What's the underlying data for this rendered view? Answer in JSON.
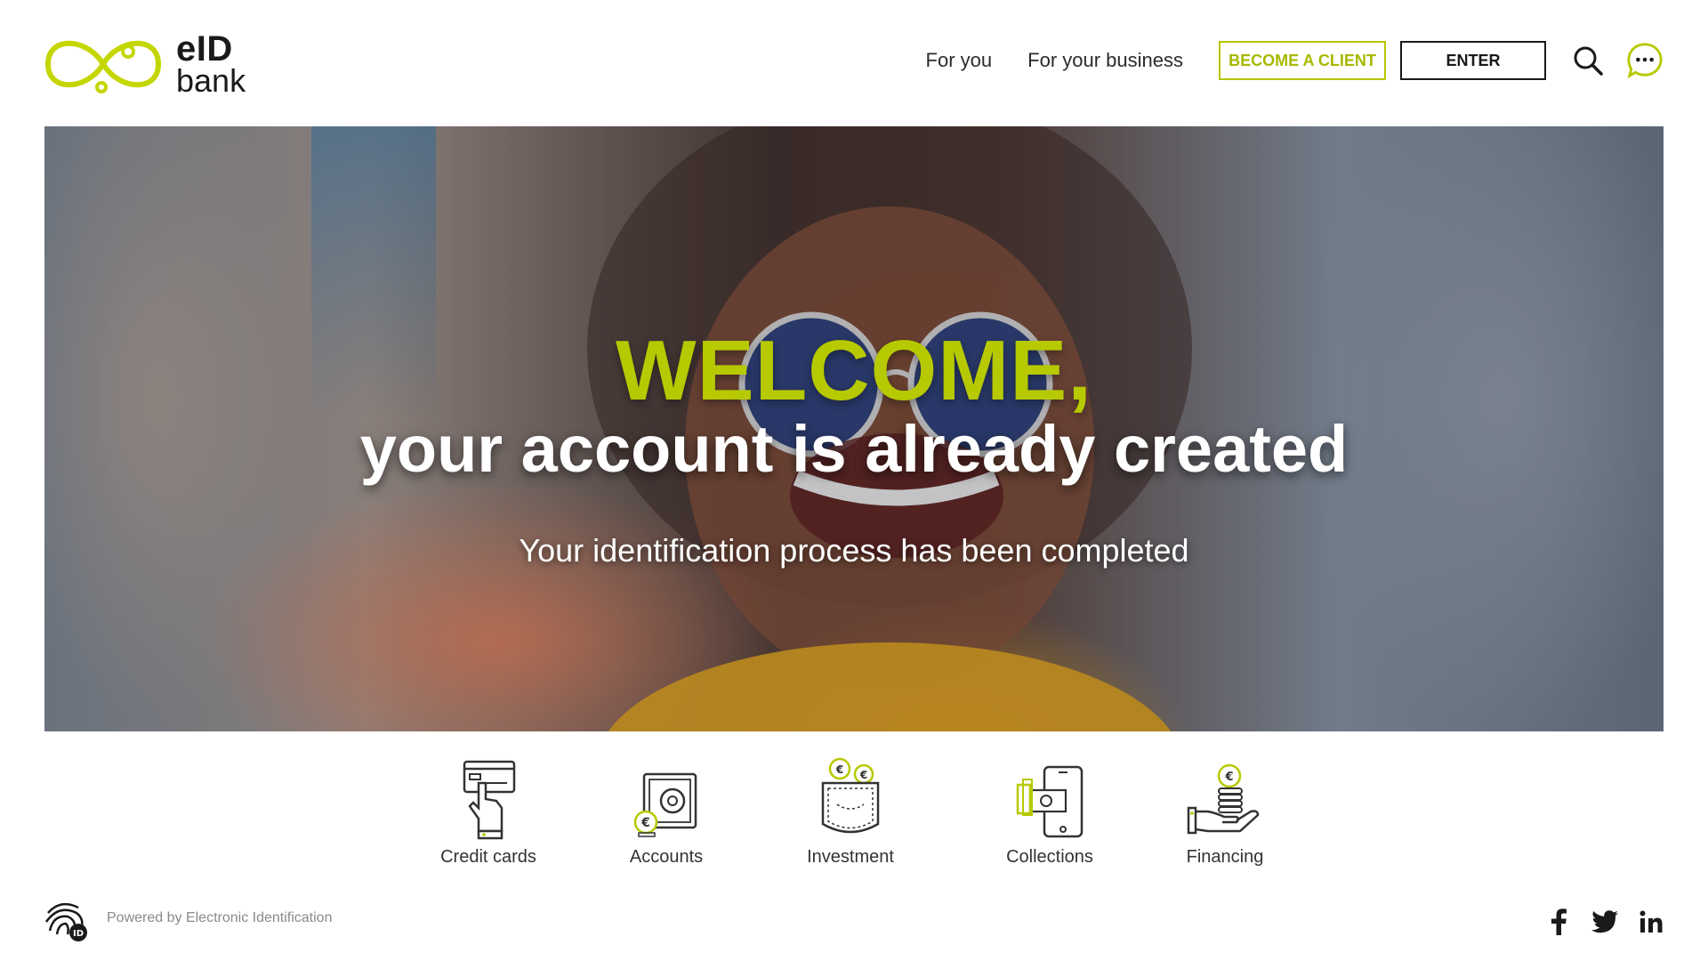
{
  "header": {
    "logo": {
      "line1": "eID",
      "line2": "bank"
    },
    "nav": {
      "for_you": "For you",
      "for_business": "For your business"
    },
    "buttons": {
      "become_client": "BECOME A CLIENT",
      "enter": "ENTER"
    },
    "icons": {
      "search": "search-icon",
      "chat": "chat-bubble-icon"
    }
  },
  "hero": {
    "welcome": "WELCOME,",
    "headline": "your account is already created",
    "subtitle": "Your identification process has been completed"
  },
  "services": [
    {
      "label": "Credit cards",
      "icon": "credit-card-hand-icon"
    },
    {
      "label": "Accounts",
      "icon": "safe-euro-icon"
    },
    {
      "label": "Investment",
      "icon": "pocket-coins-icon"
    },
    {
      "label": "Collections",
      "icon": "mobile-payment-icon"
    },
    {
      "label": "Financing",
      "icon": "hand-coins-icon"
    }
  ],
  "footer": {
    "powered_by": "Powered by Electronic Identification",
    "social": [
      "facebook-icon",
      "twitter-icon",
      "linkedin-icon"
    ]
  },
  "colors": {
    "accent": "#b7c900",
    "text": "#222222",
    "muted": "#8a8a8a"
  }
}
